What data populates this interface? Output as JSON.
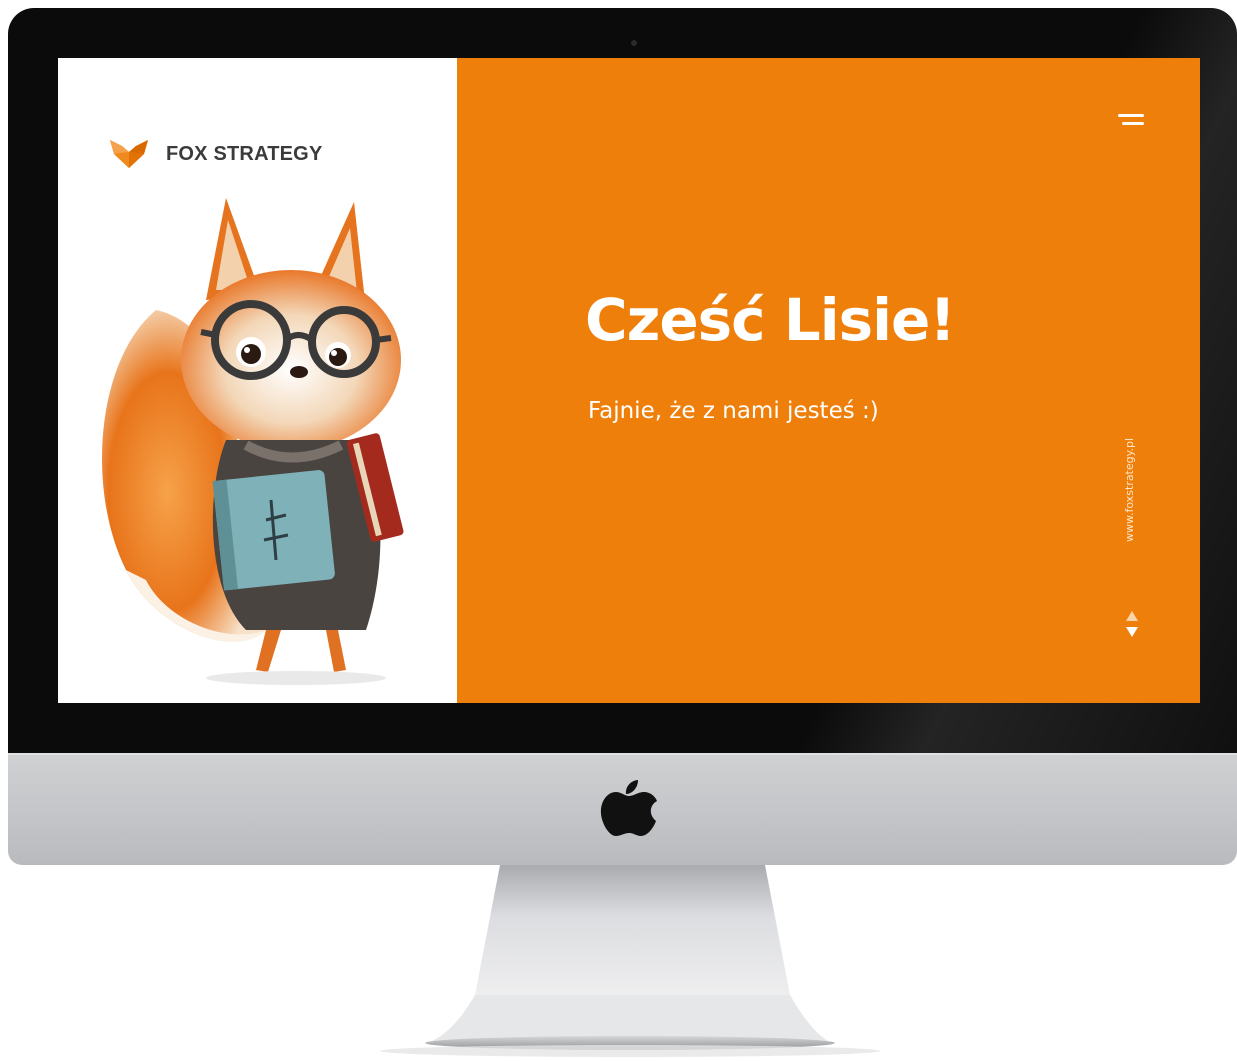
{
  "brand": {
    "name": "FOX STRATEGY"
  },
  "hero": {
    "title": "Cześć Lisie!",
    "subtitle": "Fajnie, że z nami jesteś :)",
    "website": "www.foxstrategy.pl"
  },
  "icons": {
    "logo": "fox-logo-icon",
    "menu": "hamburger-menu-icon",
    "scroll": "up-down-arrows-icon",
    "device": "apple-logo-icon"
  },
  "colors": {
    "accent": "#ef7f0b",
    "bezel": "#0b0b0b",
    "chin": "#c3c5c8",
    "brand_text": "#3b3b3b"
  }
}
